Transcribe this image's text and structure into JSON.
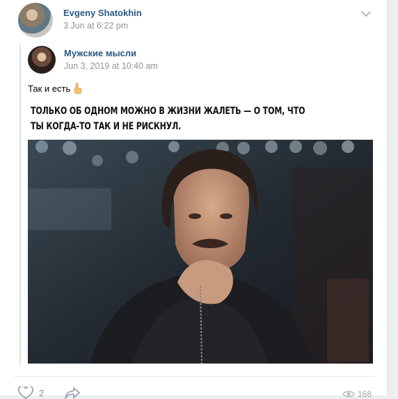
{
  "post": {
    "author": "Evgeny Shatokhin",
    "date": "3 Jun at 6:22 pm"
  },
  "repost": {
    "author": "Мужские мысли",
    "date": "Jun 3, 2019 at 10:40 am",
    "text": "Так и есть",
    "image_caption_line1": "ТОЛЬКО ОБ ОДНОМ МОЖНО В ЖИЗНИ ЖАЛЕТЬ — О ТОМ, ЧТО",
    "image_caption_line2": "ТЫ КОГДА-ТО ТАК И НЕ РИСКНУЛ."
  },
  "actions": {
    "likes": "2",
    "views": "168"
  },
  "icons": {
    "menu": "chevron-down-icon",
    "emoji": "hand-pointing-down-icon",
    "like": "heart-icon",
    "share": "share-arrow-icon",
    "views": "eye-icon"
  },
  "colors": {
    "link": "#2a5885",
    "muted": "#939393",
    "background": "#edeef0"
  }
}
